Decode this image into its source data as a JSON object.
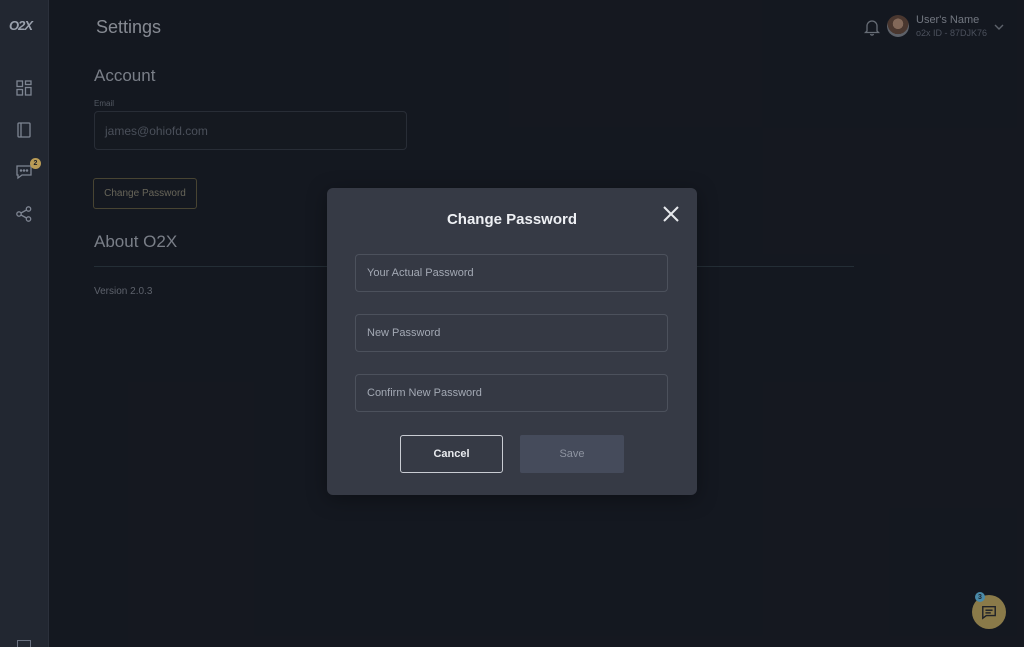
{
  "app": {
    "logo_text": "O2X"
  },
  "topbar": {
    "title": "Settings",
    "user_name": "User's Name",
    "user_id": "o2x ID - 87DJK76"
  },
  "sidebar": {
    "items": [
      {
        "icon": "dashboard-icon"
      },
      {
        "icon": "notebook-icon"
      },
      {
        "icon": "messages-icon",
        "badge": "2"
      },
      {
        "icon": "share-icon"
      }
    ]
  },
  "account": {
    "title": "Account",
    "email_label": "Email",
    "email_value": "james@ohiofd.com",
    "change_password_label": "Change Password"
  },
  "about": {
    "title": "About O2X",
    "version": "Version 2.0.3"
  },
  "modal": {
    "title": "Change Password",
    "current_placeholder": "Your Actual Password",
    "new_placeholder": "New Password",
    "confirm_placeholder": "Confirm New Password",
    "cancel_label": "Cancel",
    "save_label": "Save"
  },
  "chat": {
    "badge": "3"
  },
  "colors": {
    "background": "#1b1f29",
    "sidebar": "#222731",
    "modal": "#363a45",
    "accent_gold": "#b99b56",
    "save_disabled": "#454b5b"
  }
}
